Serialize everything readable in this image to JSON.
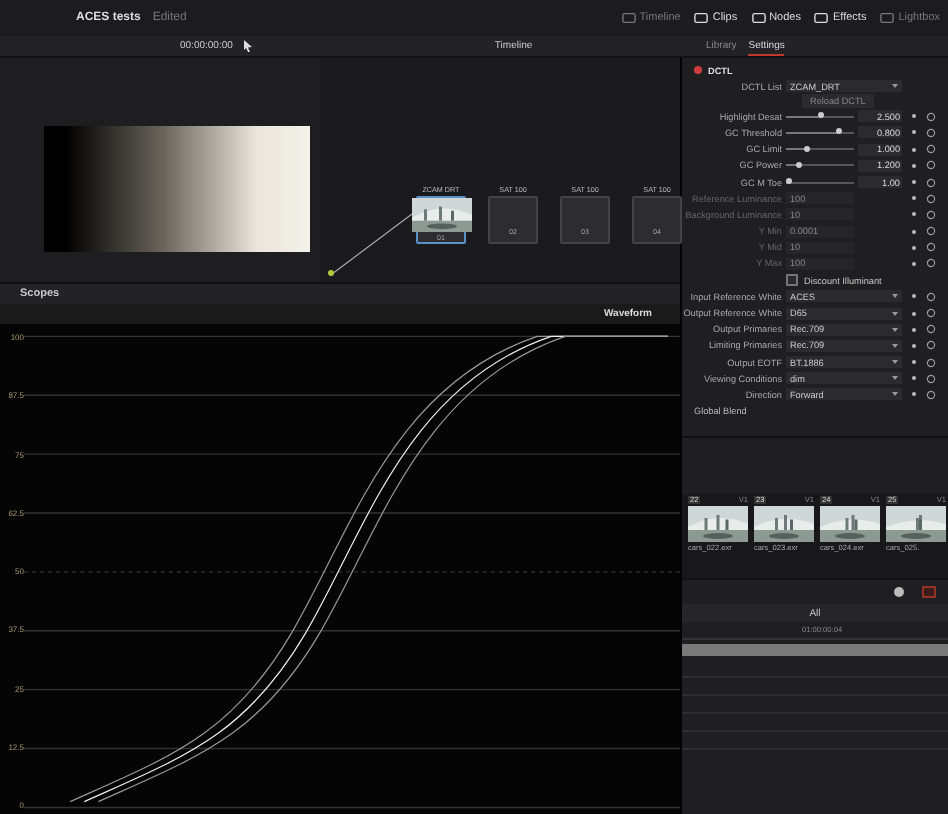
{
  "project": {
    "title": "ACES tests",
    "status": "Edited"
  },
  "page_buttons": [
    {
      "label": "Timeline",
      "selected": false
    },
    {
      "label": "Clips",
      "selected": true
    },
    {
      "label": "Nodes",
      "selected": true
    },
    {
      "label": "Effects",
      "selected": true
    },
    {
      "label": "Lightbox",
      "selected": false
    }
  ],
  "viewer": {
    "timecode": "00:00:00:00",
    "timeline": "Timeline"
  },
  "inspector_tabs": [
    {
      "label": "Library",
      "selected": false
    },
    {
      "label": "Settings",
      "selected": true
    }
  ],
  "nodes": [
    {
      "label": "ZCAM DRT",
      "number": "01",
      "kind": "thumbnail"
    },
    {
      "label": "SAT 100",
      "number": "02",
      "kind": "blank"
    },
    {
      "label": "SAT 100",
      "number": "03",
      "kind": "blank"
    },
    {
      "label": "SAT 100",
      "number": "04",
      "kind": "blank"
    }
  ],
  "scopes": {
    "title": "Scopes",
    "mode": "Waveform",
    "scale": [
      "100",
      "87.5",
      "75",
      "62.5",
      "50",
      "37.5",
      "25",
      "12.5",
      "0"
    ]
  },
  "dctl": {
    "title": "DCTL",
    "list_label": "DCTL List",
    "list_value": "ZCAM_DRT",
    "reload": "Reload DCTL",
    "global_blend": "Global Blend",
    "params": [
      {
        "kind": "slider",
        "label": "Highlight Desat",
        "level": 0.5,
        "value": "2.500"
      },
      {
        "kind": "slider",
        "label": "GC Threshold",
        "level": 0.78,
        "value": "0.800"
      },
      {
        "kind": "slider",
        "label": "GC Limit",
        "level": 0.3,
        "value": "1.000"
      },
      {
        "kind": "slider",
        "label": "GC Power",
        "level": 0.18,
        "value": "1.200"
      },
      {
        "kind": "slider",
        "label": "GC M Toe",
        "level": 0.05,
        "value": "1.00"
      },
      {
        "kind": "field",
        "label": "Reference Luminance",
        "value": "100",
        "disabled": true
      },
      {
        "kind": "field",
        "label": "Background Luminance",
        "value": "10",
        "disabled": true
      },
      {
        "kind": "field",
        "label": "Y Min",
        "value": "0.0001",
        "disabled": true
      },
      {
        "kind": "field",
        "label": "Y Mid",
        "value": "10",
        "disabled": true
      },
      {
        "kind": "field",
        "label": "Y Max",
        "value": "100",
        "disabled": true
      },
      {
        "kind": "checkbox",
        "label": "Discount Illuminant",
        "checked": false
      },
      {
        "kind": "dropdown",
        "label": "Input Reference White",
        "value": "ACES"
      },
      {
        "kind": "dropdown",
        "label": "Output Reference White",
        "value": "D65"
      },
      {
        "kind": "dropdown",
        "label": "Output Primaries",
        "value": "Rec.709"
      },
      {
        "kind": "dropdown",
        "label": "Limiting Primaries",
        "value": "Rec.709"
      },
      {
        "kind": "dropdown",
        "label": "Output EOTF",
        "value": "BT.1886"
      },
      {
        "kind": "dropdown",
        "label": "Viewing Conditions",
        "value": "dim"
      },
      {
        "kind": "dropdown",
        "label": "Direction",
        "value": "Forward"
      }
    ]
  },
  "clips": [
    {
      "number": "22",
      "track": "V1",
      "name": "cars_022.exr"
    },
    {
      "number": "23",
      "track": "V1",
      "name": "cars_023.exr"
    },
    {
      "number": "24",
      "track": "V1",
      "name": "cars_024.exr"
    },
    {
      "number": "25",
      "track": "V1",
      "name": "cars_025."
    }
  ],
  "timeline": {
    "filter": "All",
    "timecode": "01:00:00:04"
  }
}
